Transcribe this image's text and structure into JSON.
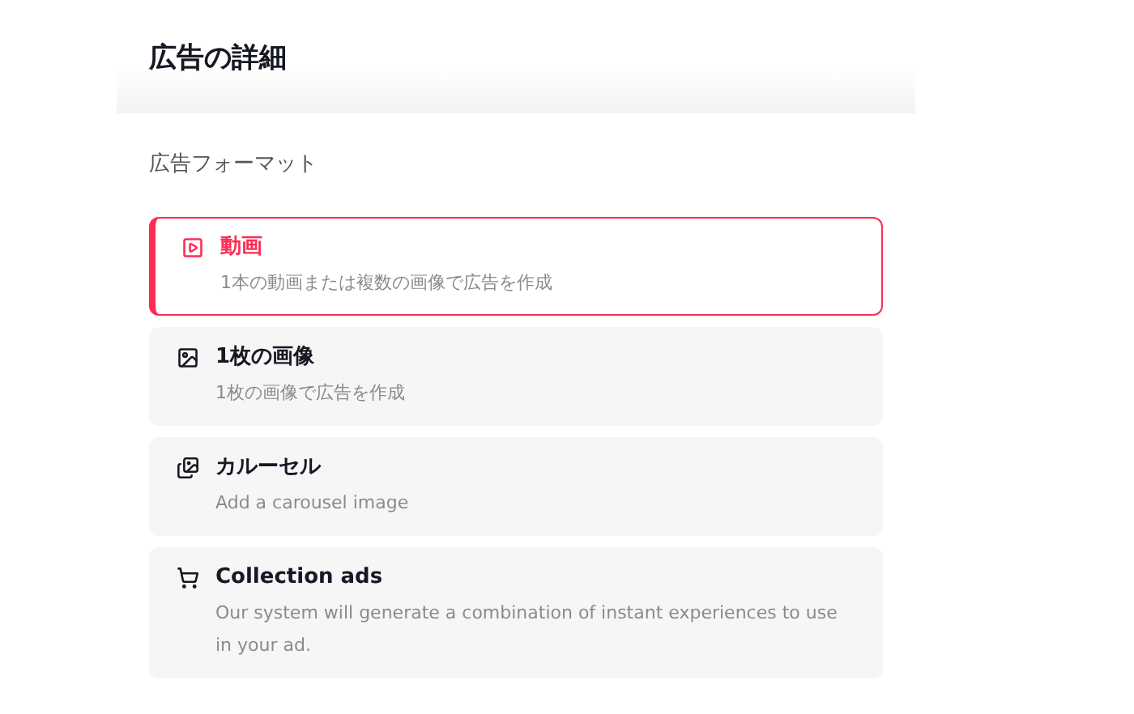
{
  "panel": {
    "title": "広告の詳細"
  },
  "section": {
    "label": "広告フォーマット"
  },
  "formats": [
    {
      "kind": "video",
      "title": "動画",
      "description": "1本の動画または複数の画像で広告を作成",
      "selected": true
    },
    {
      "kind": "image",
      "title": "1枚の画像",
      "description": "1枚の画像で広告を作成",
      "selected": false
    },
    {
      "kind": "carousel",
      "title": "カルーセル",
      "description": "Add a carousel image",
      "selected": false
    },
    {
      "kind": "collection",
      "title": "Collection ads",
      "description": "Our system will generate a combination of instant experiences to use in your ad.",
      "selected": false
    }
  ]
}
